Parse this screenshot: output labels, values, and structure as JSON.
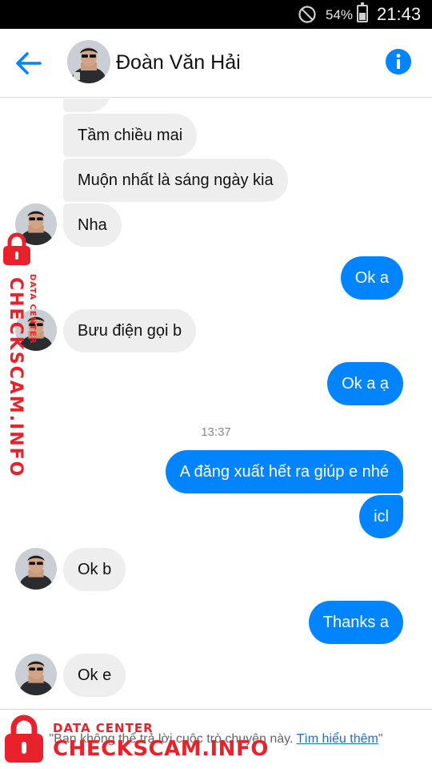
{
  "status_bar": {
    "battery_percent": "54%",
    "time": "21:43",
    "icons": [
      "do-not-disturb-icon",
      "battery-icon"
    ]
  },
  "header": {
    "contact_name": "Đoàn Văn Hải",
    "icons": [
      "back-arrow-icon",
      "info-icon"
    ],
    "accent_color": "#0084ff"
  },
  "conversation": {
    "timestamp": "13:37",
    "messages": [
      {
        "sender": "contact",
        "text": ""
      },
      {
        "sender": "contact",
        "text": "Tầm chiều mai"
      },
      {
        "sender": "contact",
        "text": "Muộn nhất là sáng ngày kia"
      },
      {
        "sender": "contact",
        "text": "Nha"
      },
      {
        "sender": "me",
        "text": "Ok a"
      },
      {
        "sender": "contact",
        "text": "Bưu điện gọi b"
      },
      {
        "sender": "me",
        "text": "Ok a ạ"
      },
      {
        "sender": "me",
        "text": "A đăng xuất hết ra giúp e nhé"
      },
      {
        "sender": "me",
        "text": "icl"
      },
      {
        "sender": "contact",
        "text": "Ok b"
      },
      {
        "sender": "me",
        "text": "Thanks a"
      },
      {
        "sender": "contact",
        "text": "Ok e"
      }
    ],
    "colors": {
      "incoming_bubble": "#eeeeef",
      "outgoing_bubble": "#0084ff"
    }
  },
  "footer": {
    "notice": "\"Bạn không thể trả lời cuộc trò chuyện này.",
    "link_text": "Tìm hiểu thêm",
    "closing_quote": "\""
  },
  "watermark": {
    "brand": "CHECKSCAM.INFO",
    "tagline": "DATA CENTER",
    "color": "#e8212b"
  }
}
